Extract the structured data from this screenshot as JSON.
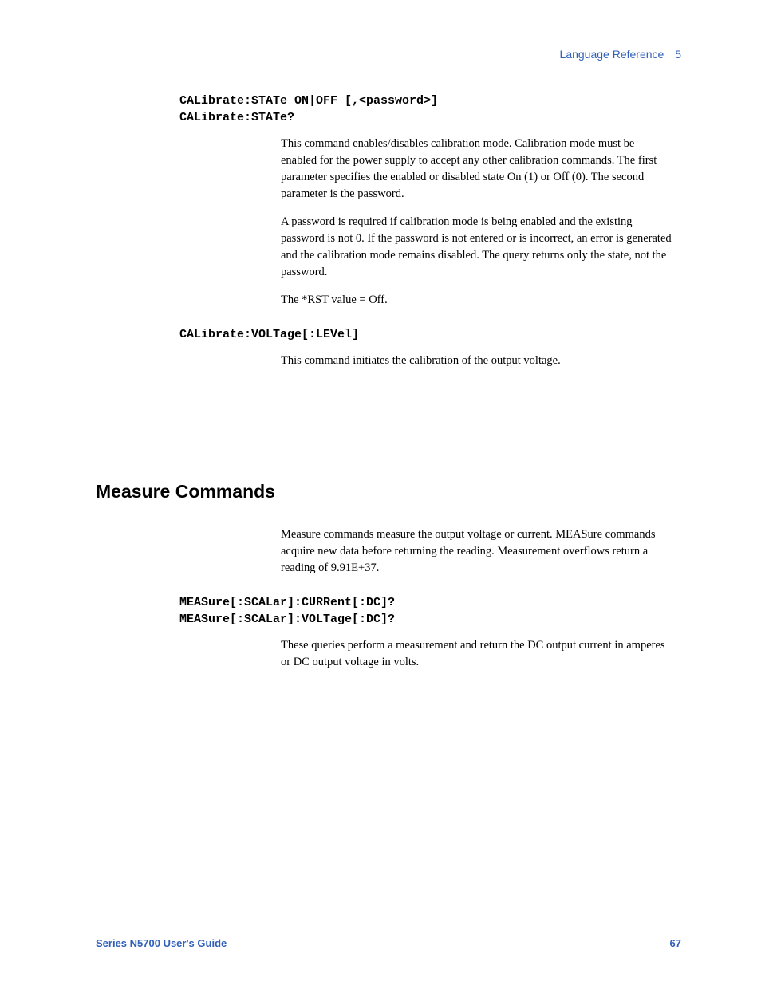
{
  "header": {
    "section_title": "Language Reference",
    "chapter_number": "5"
  },
  "command1": {
    "syntax_line1": "CALibrate:STATe ON|OFF [,<password>]",
    "syntax_line2": "CALibrate:STATe?",
    "para1": "This command enables/disables calibration mode. Calibration mode must be enabled for the power supply to accept any other calibration commands. The first parameter specifies the enabled or disabled state On (1) or Off (0). The second parameter is the password.",
    "para2": "A password is required if calibration mode is being enabled and the existing password is not 0.  If the password is not entered or is incorrect, an error is generated and the calibration mode remains disabled. The query returns only the state, not the password.",
    "para3": "The *RST value = Off."
  },
  "command2": {
    "syntax_line1": "CALibrate:VOLTage[:LEVel]",
    "para1": "This command initiates the calibration of the output voltage."
  },
  "section_heading": "Measure Commands",
  "section_intro": "Measure commands measure the output voltage or current. MEASure commands acquire new data before returning the reading. Measurement overflows return a reading of 9.91E+37.",
  "command3": {
    "syntax_line1": "MEASure[:SCALar]:CURRent[:DC]?",
    "syntax_line2": "MEASure[:SCALar]:VOLTage[:DC]?",
    "para1": "These queries perform a measurement and return the DC output current in amperes or DC output voltage in volts."
  },
  "footer": {
    "guide_title": "Series N5700 User's Guide",
    "page_number": "67"
  }
}
